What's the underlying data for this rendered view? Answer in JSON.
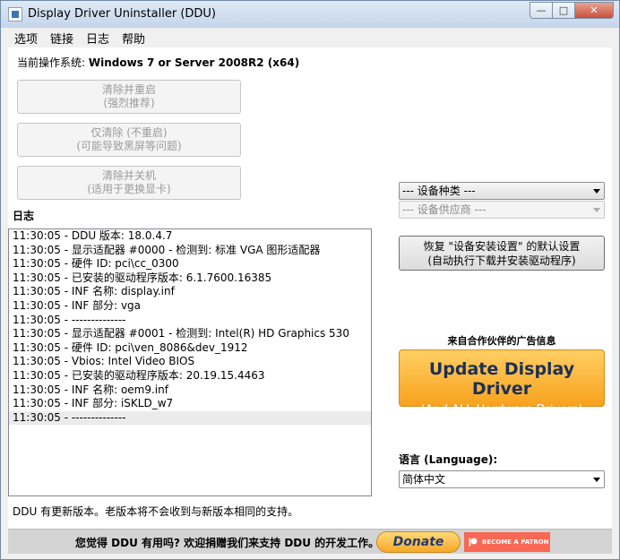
{
  "window": {
    "title": "Display Driver Uninstaller (DDU)",
    "minimize_glyph": "—",
    "maximize_glyph": "□",
    "close_glyph": "✕"
  },
  "menu": [
    "选项",
    "链接",
    "日志",
    "帮助"
  ],
  "os": {
    "label": "当前操作系统:",
    "value": "Windows 7 or Server 2008R2 (x64)"
  },
  "buttons": {
    "clean_restart": {
      "line1": "清除并重启",
      "line2": "(强烈推荐)"
    },
    "clean_only": {
      "line1": "仅清除 (不重启)",
      "line2": "(可能导致黑屏等问题)"
    },
    "clean_shutdown": {
      "line1": "清除并关机",
      "line2": "(适用于更换显卡)"
    },
    "restore": {
      "line1": "恢复 \"设备安装设置\" 的默认设置",
      "line2": "(自动执行下载并安装驱动程序)"
    }
  },
  "device_type": {
    "selected": "--- 设备种类 ---"
  },
  "device_vendor": {
    "selected": "--- 设备供应商 ---"
  },
  "log": {
    "heading": "日志",
    "lines": [
      "11:30:05 - DDU 版本: 18.0.4.7",
      "11:30:05 - 显示适配器 #0000 - 检测到: 标准 VGA 图形适配器",
      "11:30:05 - 硬件 ID: pci\\cc_0300",
      "11:30:05 - 已安装的驱动程序版本: 6.1.7600.16385",
      "11:30:05 - INF 名称: display.inf",
      "11:30:05 - INF 部分: vga",
      "11:30:05 - --------------",
      "11:30:05 - 显示适配器 #0001 - 检测到: Intel(R) HD Graphics 530",
      "11:30:05 - 硬件 ID: pci\\ven_8086&dev_1912",
      "11:30:05 - Vbios: Intel Video BIOS",
      "11:30:05 - 已安装的驱动程序版本: 20.19.15.4463",
      "11:30:05 - INF 名称: oem9.inf",
      "11:30:05 - INF 部分: iSKLD_w7",
      "11:30:05 - --------------"
    ]
  },
  "ad": {
    "label": "来自合作伙伴的广告信息",
    "line1": "Update Display Driver",
    "line2": "(And ALL Hardware Drivers)"
  },
  "language": {
    "label": "语言 (Language):",
    "selected": "简体中文"
  },
  "status": "DDU 有更新版本。老版本将不会收到与新版本相同的支持。",
  "footer": {
    "text": "您觉得 DDU 有用吗? 欢迎捐赠我们来支持 DDU 的开发工作。",
    "donate": "Donate",
    "patron": "BECOME A PATRON"
  }
}
